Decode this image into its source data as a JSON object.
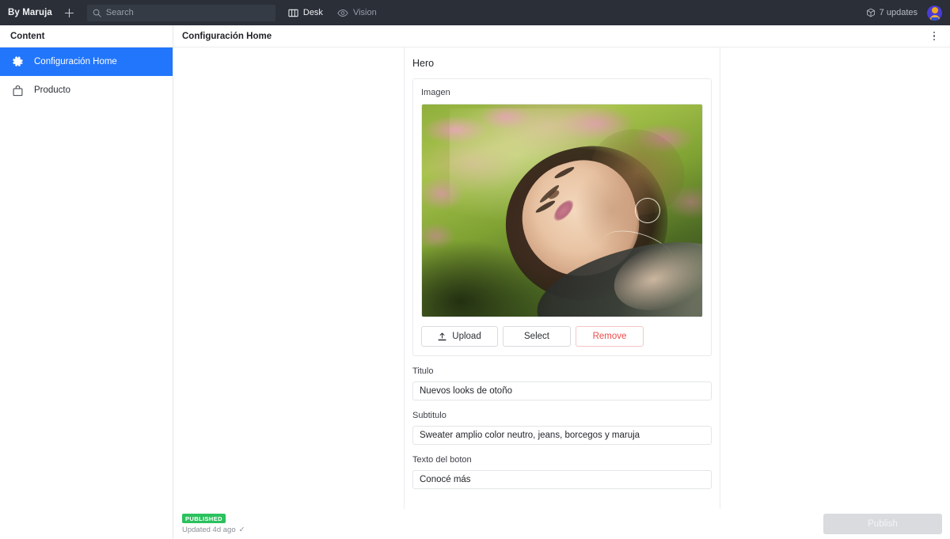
{
  "topbar": {
    "brand": "By Maruja",
    "add_label": "+",
    "search": {
      "placeholder": "Search",
      "value": "",
      "icon": "search-icon"
    },
    "nav": [
      {
        "label": "Desk",
        "icon": "panels-icon",
        "active": true
      },
      {
        "label": "Vision",
        "icon": "eye-icon",
        "active": false
      }
    ],
    "updates": {
      "label": "7 updates",
      "count": 7,
      "icon": "package-icon"
    },
    "avatar_alt": "user-avatar"
  },
  "sidebar": {
    "header": "Content",
    "items": [
      {
        "label": "Configuración Home",
        "icon": "gear-icon",
        "selected": true
      },
      {
        "label": "Producto",
        "icon": "bag-icon",
        "selected": false
      }
    ]
  },
  "document": {
    "title": "Configuración Home",
    "menu_icon": "kebab-menu-icon",
    "section_title": "Hero",
    "image_field": {
      "label": "Imagen",
      "alt": "Mujer recostada sobre el césped con flores rosadas",
      "buttons": [
        {
          "label": "Upload",
          "icon": "upload-icon",
          "style": "default"
        },
        {
          "label": "Select",
          "icon": "",
          "style": "default"
        },
        {
          "label": "Remove",
          "icon": "",
          "style": "danger"
        }
      ]
    },
    "fields": [
      {
        "label": "Titulo",
        "value": "Nuevos looks de otoño",
        "placeholder": ""
      },
      {
        "label": "Subtitulo",
        "value": "Sweater amplio color neutro, jeans, borcegos y maruja",
        "placeholder": ""
      },
      {
        "label": "Texto del boton",
        "value": "Conocé más",
        "placeholder": ""
      }
    ]
  },
  "footer": {
    "status_badge": "PUBLISHED",
    "updated_text": "Updated 4d ago",
    "updated_check": "✓",
    "publish_label": "Publish"
  },
  "colors": {
    "topbar_bg": "#2a2f38",
    "accent_blue": "#2276fc",
    "published_green": "#2bc15e",
    "danger_red": "#ef4b4b"
  }
}
